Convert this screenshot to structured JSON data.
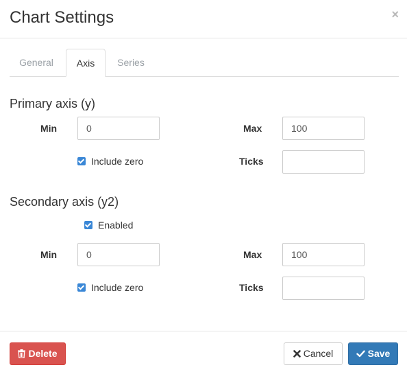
{
  "dialog": {
    "title": "Chart Settings",
    "close_glyph": "×",
    "close_icon": "close-icon"
  },
  "tabs": [
    {
      "label": "General",
      "active": false
    },
    {
      "label": "Axis",
      "active": true
    },
    {
      "label": "Series",
      "active": false
    }
  ],
  "primary_axis": {
    "title": "Primary axis (y)",
    "min_label": "Min",
    "min_value": "0",
    "max_label": "Max",
    "max_value": "100",
    "include_zero_label": "Include zero",
    "include_zero_checked": true,
    "ticks_label": "Ticks",
    "ticks_value": ""
  },
  "secondary_axis": {
    "title": "Secondary axis (y2)",
    "enabled_label": "Enabled",
    "enabled_checked": true,
    "min_label": "Min",
    "min_value": "0",
    "max_label": "Max",
    "max_value": "100",
    "include_zero_label": "Include zero",
    "include_zero_checked": true,
    "ticks_label": "Ticks",
    "ticks_value": ""
  },
  "footer": {
    "delete_label": "Delete",
    "delete_icon": "trash-icon",
    "cancel_label": "Cancel",
    "cancel_icon": "x-icon",
    "save_label": "Save",
    "save_icon": "checkmark-icon"
  },
  "colors": {
    "checkbox": "#3a87d6",
    "delete": "#d9534f",
    "save": "#337ab7"
  }
}
